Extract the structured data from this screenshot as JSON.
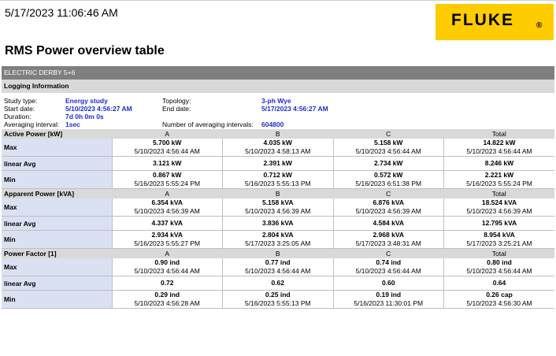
{
  "header": {
    "timestamp": "5/17/2023 11:06:46 AM",
    "logo_text": "FLUKE",
    "logo_mark": "®",
    "page_title": "RMS Power overview table"
  },
  "colors": {
    "logo_bg": "#ffcc00",
    "section_bar": "#7f7f7f",
    "value_blue": "#1f2bd4",
    "group_bg": "#d9d9d9",
    "label_bg": "#d9e1f2"
  },
  "report": {
    "name": "ELECTRIC DERBY 5+6",
    "logging_title": "Logging Information",
    "logging": {
      "study_type_label": "Study type:",
      "study_type": "Energy study",
      "start_date_label": "Start date:",
      "start_date": "5/10/2023 4:56:27 AM",
      "duration_label": "Duration:",
      "duration": "7d 0h 0m 0s",
      "averaging_interval_label": "Averaging interval:",
      "averaging_interval": "1sec",
      "topology_label": "Topology:",
      "topology": "3-ph Wye",
      "end_date_label": "End date:",
      "end_date": "5/17/2023 4:56:27 AM",
      "num_intervals_label": "Number of averaging intervals:",
      "num_intervals": "604800"
    },
    "groups": [
      {
        "name": "Active Power [kW]",
        "columns": [
          "A",
          "B",
          "C",
          "Total"
        ],
        "rows": [
          {
            "label": "Max",
            "cells": [
              {
                "value": "5.700 kW",
                "time": "5/10/2023 4:56:44 AM"
              },
              {
                "value": "4.035 kW",
                "time": "5/10/2023 4:58:13 AM"
              },
              {
                "value": "5.158 kW",
                "time": "5/10/2023 4:56:44 AM"
              },
              {
                "value": "14.822 kW",
                "time": "5/10/2023 4:56:44 AM"
              }
            ]
          },
          {
            "label": "linear Avg",
            "cells": [
              {
                "value": "3.121 kW"
              },
              {
                "value": "2.391 kW"
              },
              {
                "value": "2.734 kW"
              },
              {
                "value": "8.246 kW"
              }
            ]
          },
          {
            "label": "Min",
            "cells": [
              {
                "value": "0.867 kW",
                "time": "5/16/2023 5:55:24 PM"
              },
              {
                "value": "0.712 kW",
                "time": "5/16/2023 5:55:13 PM"
              },
              {
                "value": "0.572 kW",
                "time": "5/16/2023 6:51:38 PM"
              },
              {
                "value": "2.221 kW",
                "time": "5/16/2023 5:55:24 PM"
              }
            ]
          }
        ]
      },
      {
        "name": "Apparent Power [kVA]",
        "columns": [
          "A",
          "B",
          "C",
          "Total"
        ],
        "rows": [
          {
            "label": "Max",
            "cells": [
              {
                "value": "6.354 kVA",
                "time": "5/10/2023 4:56:39 AM"
              },
              {
                "value": "5.158 kVA",
                "time": "5/10/2023 4:56:39 AM"
              },
              {
                "value": "6.876 kVA",
                "time": "5/10/2023 4:56:39 AM"
              },
              {
                "value": "18.524 kVA",
                "time": "5/10/2023 4:56:39 AM"
              }
            ]
          },
          {
            "label": "linear Avg",
            "cells": [
              {
                "value": "4.337 kVA"
              },
              {
                "value": "3.836 kVA"
              },
              {
                "value": "4.584 kVA"
              },
              {
                "value": "12.795 kVA"
              }
            ]
          },
          {
            "label": "Min",
            "cells": [
              {
                "value": "2.934 kVA",
                "time": "5/16/2023 5:55:27 PM"
              },
              {
                "value": "2.804 kVA",
                "time": "5/17/2023 3:25:05 AM"
              },
              {
                "value": "2.968 kVA",
                "time": "5/17/2023 3:48:31 AM"
              },
              {
                "value": "8.954 kVA",
                "time": "5/17/2023 3:25:21 AM"
              }
            ]
          }
        ]
      },
      {
        "name": "Power Factor [1]",
        "columns": [
          "A",
          "B",
          "C",
          "Total"
        ],
        "rows": [
          {
            "label": "Max",
            "cells": [
              {
                "value": "0.90 ind",
                "time": "5/10/2023 4:56:44 AM"
              },
              {
                "value": "0.77 ind",
                "time": "5/10/2023 4:56:44 AM"
              },
              {
                "value": "0.74 ind",
                "time": "5/10/2023 4:56:44 AM"
              },
              {
                "value": "0.80 ind",
                "time": "5/10/2023 4:56:44 AM"
              }
            ]
          },
          {
            "label": "linear Avg",
            "cells": [
              {
                "value": "0.72"
              },
              {
                "value": "0.62"
              },
              {
                "value": "0.60"
              },
              {
                "value": "0.64"
              }
            ]
          },
          {
            "label": "Min",
            "cells": [
              {
                "value": "0.29 ind",
                "time": "5/10/2023 4:56:28 AM"
              },
              {
                "value": "0.25 ind",
                "time": "5/16/2023 5:55:13 PM"
              },
              {
                "value": "0.19 ind",
                "time": "5/16/2023 11:30:01 PM"
              },
              {
                "value": "0.26 cap",
                "time": "5/10/2023 4:56:30 AM"
              }
            ]
          }
        ]
      }
    ]
  }
}
